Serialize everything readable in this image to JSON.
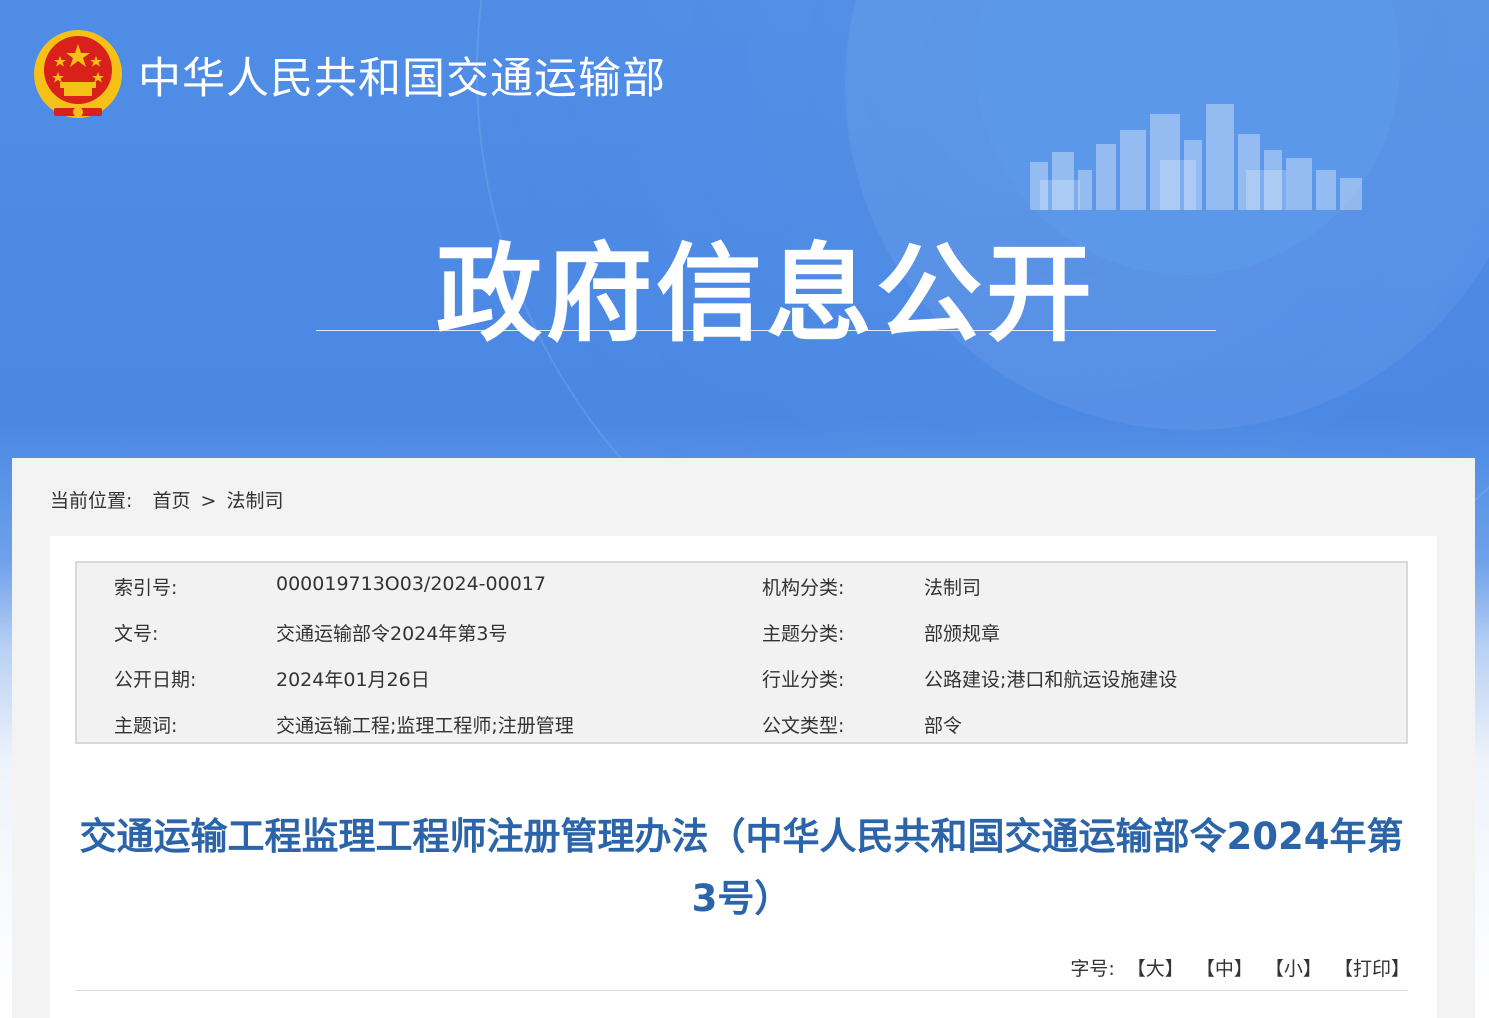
{
  "header": {
    "site_name": "中华人民共和国交通运输部"
  },
  "banner": {
    "title": "政府信息公开"
  },
  "breadcrumb": {
    "label": "当前位置:",
    "home": "首页",
    "separator": ">",
    "current": "法制司"
  },
  "meta": {
    "rows": [
      {
        "k1": "索引号:",
        "v1": "000019713O03/2024-00017",
        "k2": "机构分类:",
        "v2": "法制司"
      },
      {
        "k1": "文号:",
        "v1": "交通运输部令2024年第3号",
        "k2": "主题分类:",
        "v2": "部颁规章"
      },
      {
        "k1": "公开日期:",
        "v1": "2024年01月26日",
        "k2": "行业分类:",
        "v2": "公路建设;港口和航运设施建设"
      },
      {
        "k1": "主题词:",
        "v1": "交通运输工程;监理工程师;注册管理",
        "k2": "公文类型:",
        "v2": "部令"
      }
    ]
  },
  "document": {
    "title": "交通运输工程监理工程师注册管理办法（中华人民共和国交通运输部令2024年第3号）"
  },
  "toolbar": {
    "font_label": "字号:",
    "large": "【大】",
    "medium": "【中】",
    "small": "【小】",
    "print": "【打印】"
  },
  "colors": {
    "banner_blue": "#4a88e4",
    "title_blue": "#2b64a8",
    "emblem_red": "#d9201a",
    "emblem_gold": "#f5c116"
  },
  "icons": {
    "emblem": "national-emblem-icon",
    "skyline": "city-skyline-decoration"
  }
}
